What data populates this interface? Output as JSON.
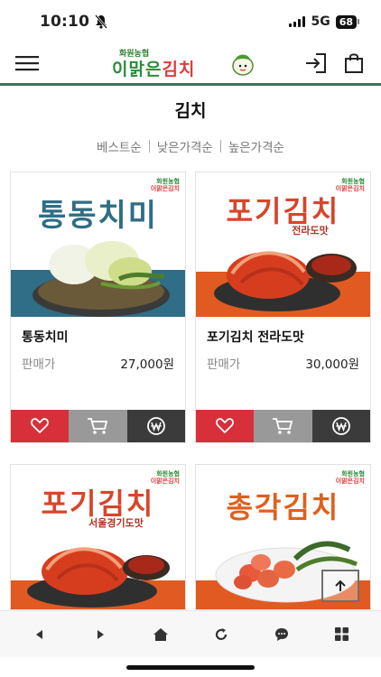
{
  "status": {
    "time": "10:10",
    "network": "5G",
    "battery": "68"
  },
  "header": {
    "logo_top": "화원농협",
    "logo_main_1": "이맑은",
    "logo_main_2": "김치"
  },
  "page": {
    "title": "김치"
  },
  "sort": [
    "베스트순",
    "낮은가격순",
    "높은가격순"
  ],
  "products": [
    {
      "name": "통동치미",
      "price_label": "판매가",
      "price": "27,000원",
      "banner": "통동치미",
      "banner_sub": ""
    },
    {
      "name": "포기김치 전라도맛",
      "price_label": "판매가",
      "price": "30,000원",
      "banner": "포기김치",
      "banner_sub": "전라도맛"
    },
    {
      "name": "",
      "price_label": "",
      "price": "",
      "banner": "포기김치",
      "banner_sub": "서울경기도맛"
    },
    {
      "name": "",
      "price_label": "",
      "price": "",
      "banner": "총각김치",
      "banner_sub": ""
    }
  ],
  "brand_mini": {
    "line1": "화원농협",
    "line2": "이맑은김치"
  },
  "colors": {
    "accent_line": "#2f7a5c",
    "like": "#d8303a",
    "cart": "#999999",
    "buy": "#3b3b3b",
    "banner_teal": "#2f6e86",
    "banner_orange": "#e05a22"
  },
  "icons": {
    "menu": "hamburger-icon",
    "login": "login-icon",
    "bag": "shopping-bag-icon",
    "like": "heart-icon",
    "cart": "cart-icon",
    "buy": "won-icon",
    "top": "arrow-up-icon"
  }
}
